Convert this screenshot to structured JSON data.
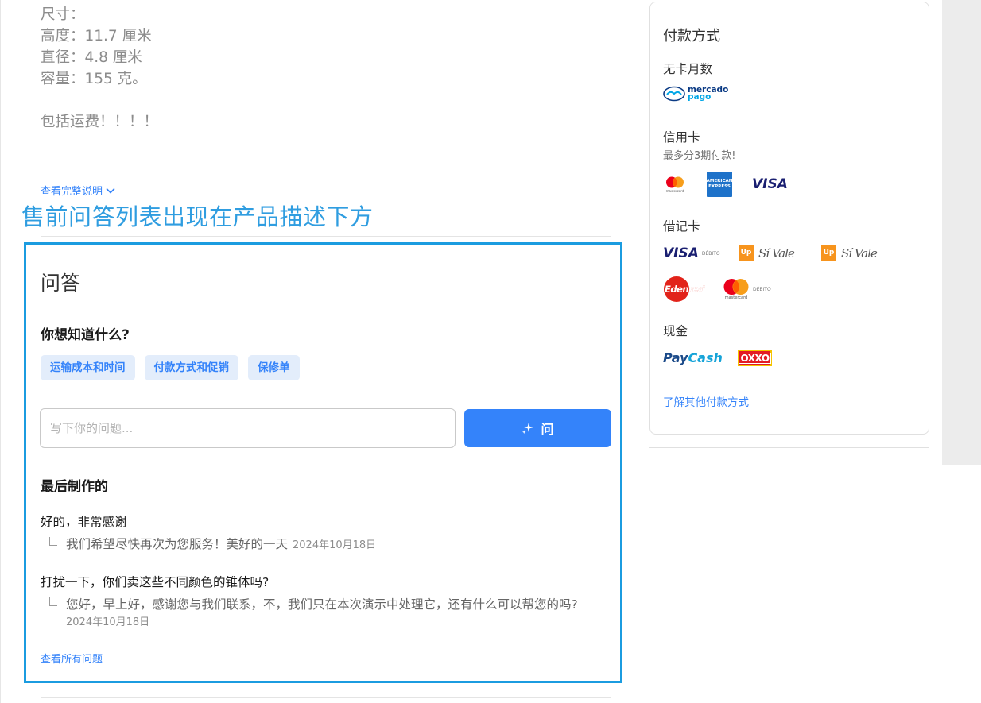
{
  "description": {
    "lines": [
      "尺寸：",
      "高度：11.7 厘米",
      "直径：4.8 厘米",
      "容量：155 克。"
    ],
    "shipping": "包括运费！！！！",
    "full_link": "查看完整说明"
  },
  "annotation": "售前问答列表出现在产品描述下方",
  "qa": {
    "title": "问答",
    "ask_heading": "你想知道什么?",
    "chips": [
      "运输成本和时间",
      "付款方式和促销",
      "保修单"
    ],
    "input_placeholder": "写下你的问题...",
    "ask_button": "问",
    "recent_heading": "最后制作的",
    "items": [
      {
        "question": "好的，非常感谢",
        "answer": "我们希望尽快再次为您服务！美好的一天",
        "date": "2024年10月18日"
      },
      {
        "question": "打扰一下，你们卖这些不同颜色的锥体吗?",
        "answer": "您好，早上好，感谢您与我们联系，不，我们只在本次演示中处理它，还有什么可以帮您的吗?",
        "date": "2024年10月18日"
      }
    ],
    "see_all": "查看所有问题"
  },
  "payment": {
    "title": "付款方式",
    "installments": {
      "label": "无卡月数",
      "logo_text": [
        "mercado",
        "pago"
      ]
    },
    "credit": {
      "label": "信用卡",
      "sub": "最多分3期付款!",
      "logos": {
        "mastercard": "mastercard",
        "amex": [
          "AMERICAN",
          "EXPRESS"
        ],
        "visa": "VISA"
      }
    },
    "debit": {
      "label": "借记卡",
      "debito": "DÉBITO",
      "sivale": "Sí Vale",
      "up": "Up",
      "edenred": "Edenred"
    },
    "cash": {
      "label": "现金",
      "paycash": [
        "Pay",
        "Cash"
      ],
      "oxxo": "OXXO"
    },
    "more_link": "了解其他付款方式"
  },
  "colors": {
    "accent": "#3483fa",
    "annotation": "#2f9de0",
    "highlight_border": "#1b9ce0",
    "chip_bg": "#e3edfb"
  }
}
